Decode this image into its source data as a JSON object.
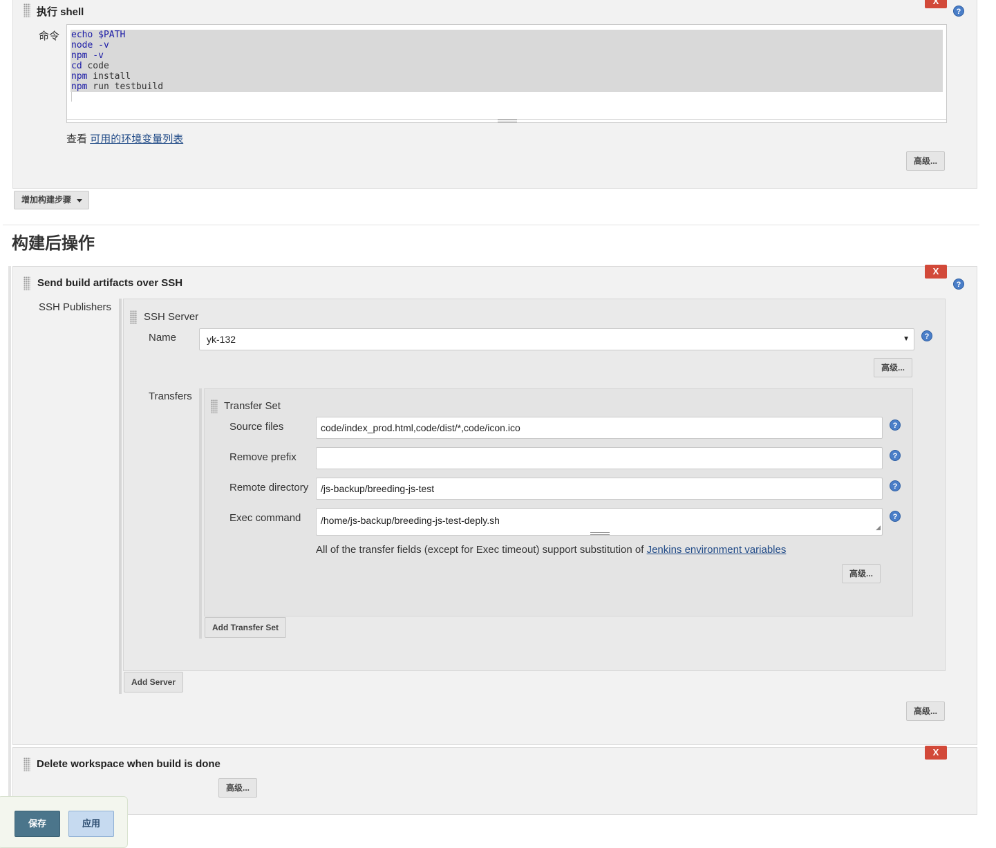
{
  "shell": {
    "title": "执行 shell",
    "command_label": "命令",
    "code_lines": [
      {
        "kw": "echo",
        "rest": " $PATH",
        "kwrest": true
      },
      {
        "kw": "node",
        "rest": " -v",
        "kwrest": true
      },
      {
        "kw": "npm",
        "rest": " -v",
        "kwrest": true
      },
      {
        "kw": "cd",
        "rest": " code",
        "kwrest": false
      },
      {
        "kw": "npm",
        "rest": " install",
        "kwrest": false
      },
      {
        "kw": "npm",
        "rest": " run testbuild",
        "kwrest": false
      }
    ],
    "env_prefix": "查看",
    "env_link": "可用的环境变量列表",
    "advanced_label": "高级...",
    "close_label": "X",
    "help_label": "?"
  },
  "add_build_step": "增加构建步骤",
  "post_build_heading": "构建后操作",
  "ssh": {
    "title": "Send build artifacts over SSH",
    "close_label": "X",
    "help_label": "?",
    "publishers_label": "SSH Publishers",
    "server": {
      "title": "SSH Server",
      "name_label": "Name",
      "name_value": "yk-132",
      "advanced_label": "高级...",
      "transfers_label": "Transfers",
      "transfer_set": {
        "title": "Transfer Set",
        "fields": [
          {
            "label": "Source files",
            "value": "code/index_prod.html,code/dist/*,code/icon.ico"
          },
          {
            "label": "Remove prefix",
            "value": ""
          },
          {
            "label": "Remote directory",
            "value": "/js-backup/breeding-js-test"
          },
          {
            "label": "Exec command",
            "value": "/home/js-backup/breeding-js-test-deply.sh"
          }
        ],
        "note_text": "All of the transfer fields (except for Exec timeout) support substitution of ",
        "note_link": "Jenkins environment variables",
        "advanced_label": "高级..."
      },
      "add_transfer_set": "Add Transfer Set"
    },
    "add_server": "Add Server",
    "advanced_label": "高级..."
  },
  "delete_ws": {
    "title": "Delete workspace when build is done",
    "close_label": "X",
    "advanced_label": "高级..."
  },
  "footer": {
    "save_label": "保存",
    "apply_label": "应用"
  }
}
